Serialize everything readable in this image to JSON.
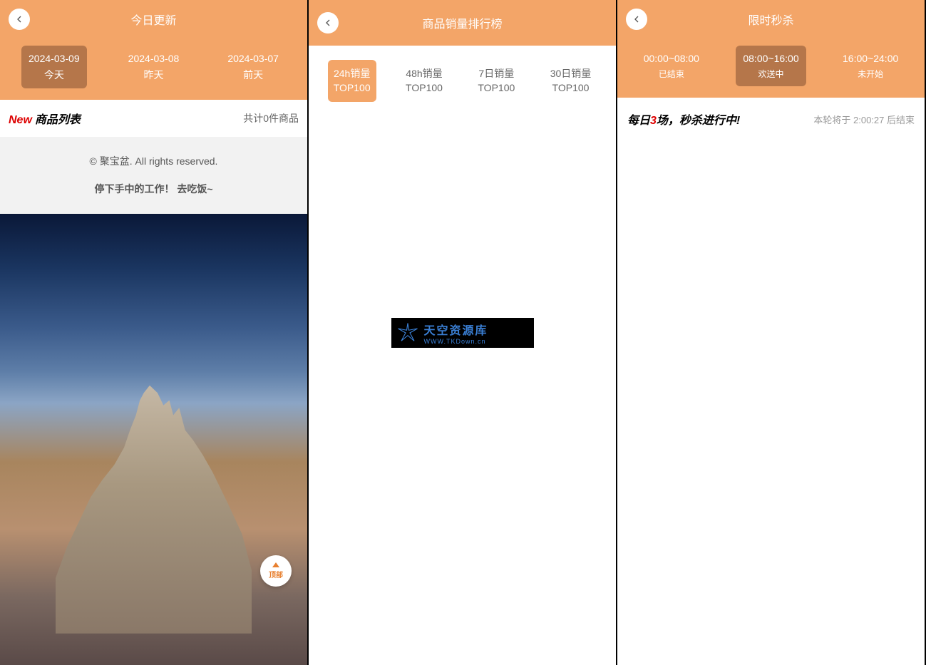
{
  "panel1": {
    "title": "今日更新",
    "tabs": [
      {
        "date": "2024-03-09",
        "label": "今天"
      },
      {
        "date": "2024-03-08",
        "label": "昨天"
      },
      {
        "date": "2024-03-07",
        "label": "前天"
      }
    ],
    "list_new": "New",
    "list_title": "商品列表",
    "list_count": "共计0件商品",
    "footer_line1": "© 聚宝盆. All rights reserved.",
    "footer_line2": "停下手中的工作！ 去吃饭~",
    "fab_label": "顶部"
  },
  "panel2": {
    "title": "商品销量排行榜",
    "tabs": [
      {
        "line1": "24h销量",
        "line2": "TOP100"
      },
      {
        "line1": "48h销量",
        "line2": "TOP100"
      },
      {
        "line1": "7日销量",
        "line2": "TOP100"
      },
      {
        "line1": "30日销量",
        "line2": "TOP100"
      }
    ],
    "watermark_cn": "天空资源库",
    "watermark_en": "WWW.TKDown.cn"
  },
  "panel3": {
    "title": "限时秒杀",
    "tabs": [
      {
        "time": "00:00~08:00",
        "status": "已结束"
      },
      {
        "time": "08:00~16:00",
        "status": "欢送中"
      },
      {
        "time": "16:00~24:00",
        "status": "未开始"
      }
    ],
    "flash_prefix": "每日",
    "flash_num": "3",
    "flash_suffix": "场，秒杀进行中!",
    "timer_text": "本轮将于 2:00:27 后结束"
  }
}
